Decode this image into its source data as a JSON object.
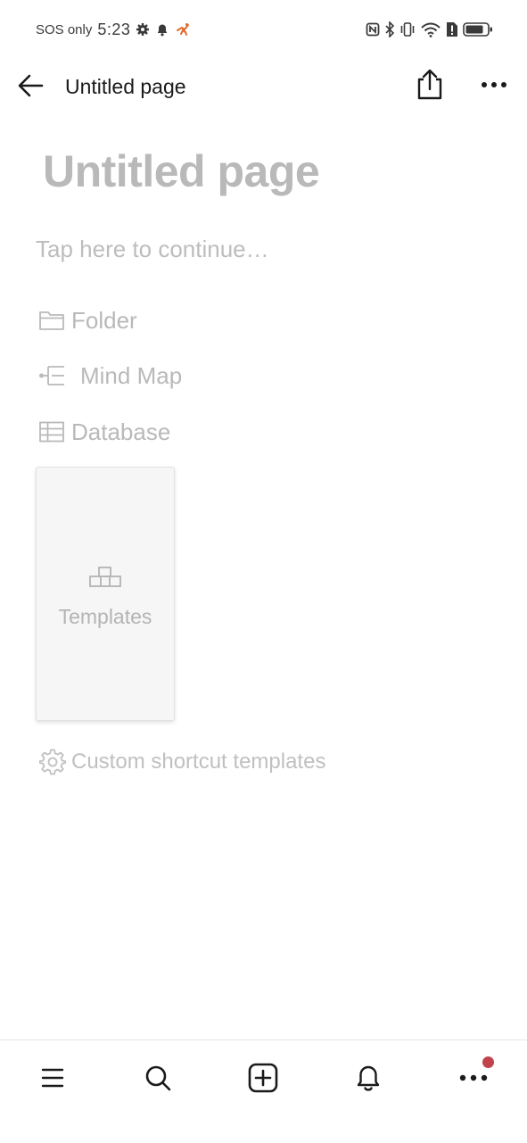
{
  "status": {
    "carrier": "SOS only",
    "time": "5:23",
    "icons": [
      "gear-icon",
      "bell-icon",
      "activity-icon",
      "nfc-icon",
      "bluetooth-icon",
      "vibrate-icon",
      "wifi-icon",
      "sim-alert-icon",
      "battery-icon"
    ]
  },
  "topbar": {
    "title": "Untitled page",
    "back_icon": "arrow-left-icon",
    "share_icon": "share-icon",
    "more_icon": "more-horizontal-icon"
  },
  "page": {
    "title": "Untitled page",
    "placeholder": "Tap here to continue…"
  },
  "options": [
    {
      "label": "Folder",
      "icon": "folder-icon"
    },
    {
      "label": "Mind Map",
      "icon": "mind-map-icon"
    },
    {
      "label": "Database",
      "icon": "table-icon"
    }
  ],
  "templates_card": {
    "label": "Templates",
    "icon": "blocks-icon"
  },
  "custom_shortcut": {
    "label": "Custom shortcut templates",
    "icon": "gear-icon"
  },
  "bottom_nav": [
    {
      "icon": "menu-icon"
    },
    {
      "icon": "search-icon"
    },
    {
      "icon": "plus-square-icon"
    },
    {
      "icon": "bell-icon"
    },
    {
      "icon": "more-horizontal-icon",
      "has_badge": true
    }
  ],
  "colors": {
    "badge": "#c0434b",
    "activity": "#e06a2a",
    "placeholder_text": "#b9b9b9"
  }
}
